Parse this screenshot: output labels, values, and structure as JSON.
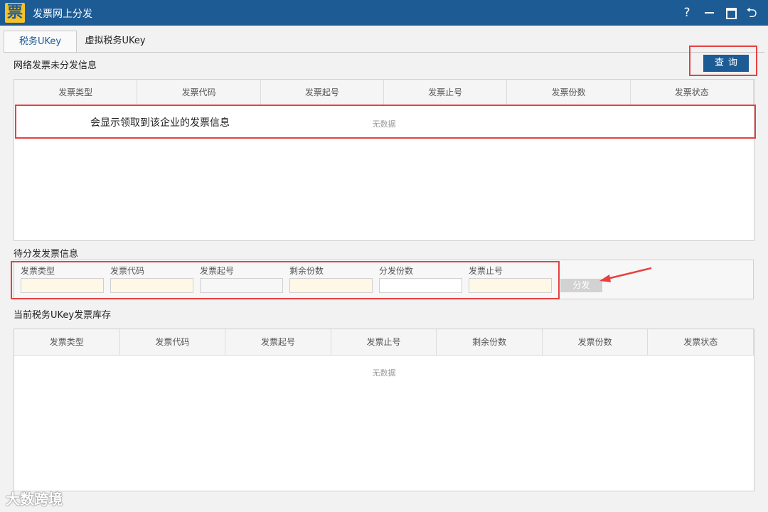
{
  "window": {
    "title": "发票网上分发",
    "logo": "票",
    "help": "?",
    "back": "⮌"
  },
  "tabs": [
    {
      "label": "税务UKey",
      "active": true
    },
    {
      "label": "虚拟税务UKey",
      "active": false
    }
  ],
  "unissued": {
    "title": "网络发票未分发信息",
    "query_label": "查询",
    "columns": [
      "发票类型",
      "发票代码",
      "发票起号",
      "发票止号",
      "发票份数",
      "发票状态"
    ],
    "empty_text": "无数据",
    "annotation": "会显示领取到该企业的发票信息"
  },
  "pending": {
    "title": "待分发发票信息",
    "fields": [
      {
        "label": "发票类型",
        "value": ""
      },
      {
        "label": "发票代码",
        "value": ""
      },
      {
        "label": "发票起号",
        "value": ""
      },
      {
        "label": "剩余份数",
        "value": ""
      },
      {
        "label": "分发份数",
        "value": ""
      },
      {
        "label": "发票止号",
        "value": ""
      }
    ],
    "distribute_label": "分发"
  },
  "inventory": {
    "title": "当前税务UKey发票库存",
    "columns": [
      "发票类型",
      "发票代码",
      "发票起号",
      "发票止号",
      "剩余份数",
      "发票份数",
      "发票状态"
    ],
    "empty_text": "无数据"
  },
  "watermark": "大数跨境",
  "colors": {
    "title_bar": "#1d5b95",
    "annotation_red": "#e84040",
    "input_highlight": "#fff8e6"
  }
}
